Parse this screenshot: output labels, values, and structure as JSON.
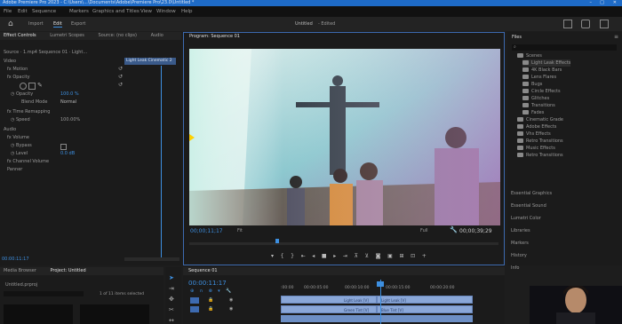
{
  "titlebar": {
    "title": "Adobe Premiere Pro 2023 - C:\\Users\\...\\Documents\\Adobe\\Premiere Pro\\23.0\\Untitled *"
  },
  "menubar": {
    "items": [
      "File",
      "Edit",
      "Sequence",
      "Markers",
      "Graphics and Titles",
      "View",
      "Window",
      "Help"
    ]
  },
  "workspace": {
    "items": [
      "Import",
      "Edit",
      "Export"
    ],
    "active": "Edit",
    "center_title": "Untitled",
    "center_sub": "- Edited"
  },
  "effect_controls": {
    "tabs": [
      "Effect Controls",
      "Lumetri Scopes",
      "Source: (no clips)",
      "Audio"
    ],
    "source_line": "Source · 1.mp4     Sequence 01 · Light...",
    "clip_bar": "Light Leak Cinematic 2",
    "video_label": "Video",
    "motion": "Motion",
    "opacity": "Opacity",
    "opacity_value": "100.0 %",
    "blend_label": "Blend Mode",
    "blend_value": "Normal",
    "time_remap": "Time Remapping",
    "speed_label": "Speed",
    "speed_value": "100.00%",
    "audio_label": "Audio",
    "volume": "Volume",
    "bypass": "Bypass",
    "level_label": "Level",
    "level_value": "0.0 dB",
    "channel_volume": "Channel Volume",
    "panner": "Panner",
    "timecode": "00:00:11:17"
  },
  "program": {
    "tab": "Program: Sequence 01",
    "timecode": "00;00;11;17",
    "fit": "Fit",
    "quality": "Full",
    "duration": "00;00;39;29"
  },
  "project": {
    "tab": "Project: Untitled",
    "media_browser": "Media Browser",
    "tab2": "Untitled.prproj",
    "count": "1 of 11 items selected"
  },
  "sequence": {
    "tab": "Sequence 01",
    "timecode": "00:00:11:17",
    "ruler": [
      ":00:00",
      "00:00:05:00",
      "00:00:10:00",
      "00:00:15:00",
      "00:00:20:00"
    ],
    "clip1": "Light Leak [V]",
    "clip2": "Green Tint [V]",
    "clip3": "Light Leak [V]",
    "clip4": "Blue Tint [V]"
  },
  "files": {
    "title": "Files",
    "items": [
      "Scenes",
      "Light Leak Effects",
      "4K Black Bars",
      "Lens Flares",
      "Bugs",
      "Circle Effects",
      "Glitches",
      "Transitions",
      "Fades",
      "Cinematic Grade",
      "Adobe Effects",
      "Vhs Effects",
      "Retro Transitions",
      "Music Effects",
      "Retro Transitions"
    ],
    "panels": [
      "Essential Graphics",
      "Essential Sound",
      "Lumetri Color",
      "Libraries",
      "Markers",
      "History",
      "Info"
    ]
  }
}
